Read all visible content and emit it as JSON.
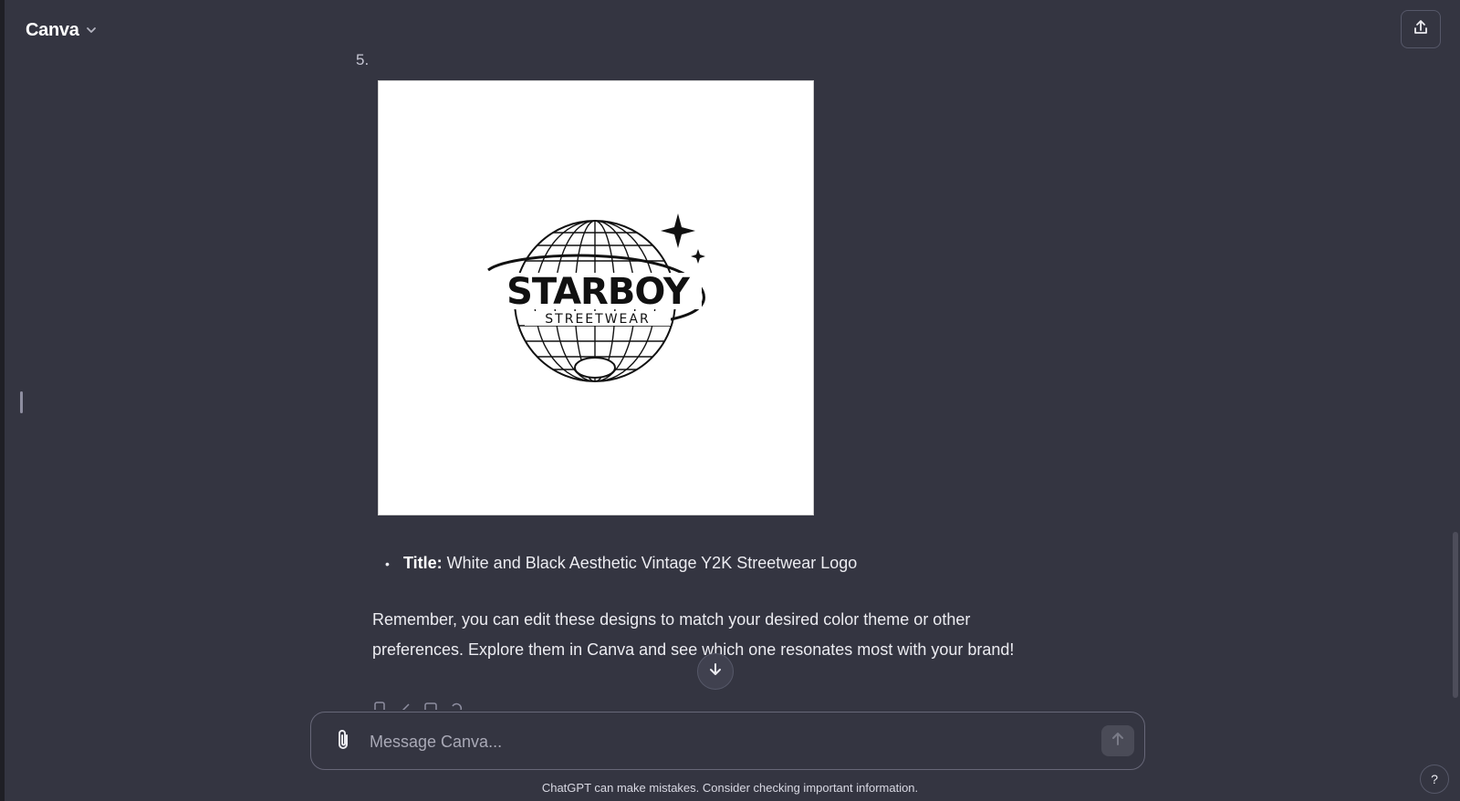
{
  "header": {
    "model_name": "Canva"
  },
  "conversation": {
    "list_number": "5.",
    "design_image": {
      "logo_main_text": "STARBOY",
      "logo_sub_text": "STREETWEAR"
    },
    "bullet": {
      "label": "Title:",
      "value": "White and Black Aesthetic Vintage Y2K Streetwear Logo"
    },
    "closing_message": "Remember, you can edit these designs to match your desired color theme or other preferences. Explore them in Canva and see which one resonates most with your brand!"
  },
  "composer": {
    "placeholder": "Message Canva..."
  },
  "footer": {
    "disclaimer": "ChatGPT can make mistakes. Consider checking important information.",
    "help_label": "?"
  },
  "colors": {
    "background": "#343541",
    "text": "#ececf1",
    "border": "#676778"
  },
  "icons": [
    "chevron-down-icon",
    "share-icon",
    "scroll-down-icon",
    "paperclip-icon",
    "send-arrow-icon",
    "copy-icon",
    "edit-icon",
    "regenerate-icon"
  ]
}
